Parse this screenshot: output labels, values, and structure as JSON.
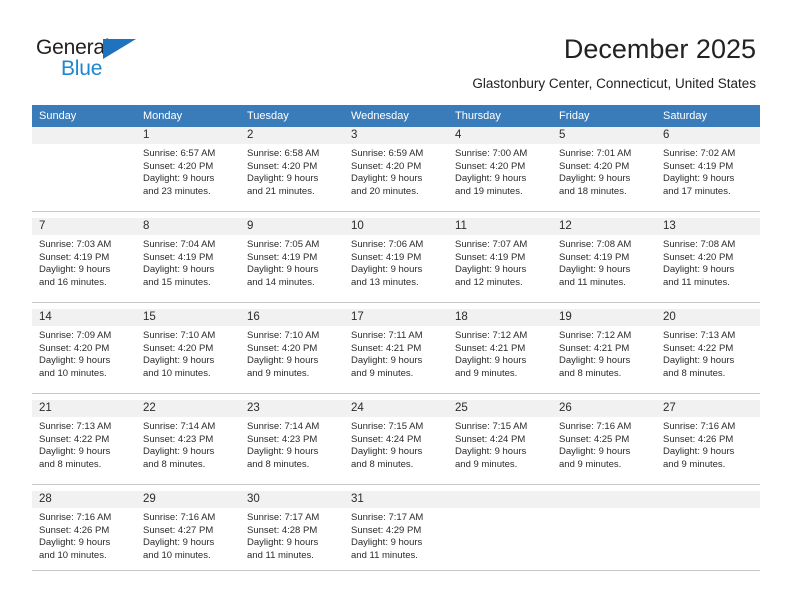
{
  "brand": {
    "name_top": "General",
    "name_bottom": "Blue",
    "color_dark": "#231f20",
    "color_blue": "#1f86d0",
    "triangle_color": "#1f72bd"
  },
  "header": {
    "month_title": "December 2025",
    "location": "Glastonbury Center, Connecticut, United States"
  },
  "theme": {
    "header_row_bg": "#3a7cba",
    "header_row_text": "#ffffff",
    "daynum_band_bg": "#f1f1f1",
    "grid_line": "#c8c8c8",
    "body_text": "#2b2b2b"
  },
  "weekday_headers": [
    "Sunday",
    "Monday",
    "Tuesday",
    "Wednesday",
    "Thursday",
    "Friday",
    "Saturday"
  ],
  "weeks": [
    [
      {
        "day": "",
        "empty": true,
        "sunrise": "",
        "sunset": "",
        "daylight_line1": "",
        "daylight_line2": ""
      },
      {
        "day": "1",
        "sunrise": "Sunrise: 6:57 AM",
        "sunset": "Sunset: 4:20 PM",
        "daylight_line1": "Daylight: 9 hours",
        "daylight_line2": "and 23 minutes."
      },
      {
        "day": "2",
        "sunrise": "Sunrise: 6:58 AM",
        "sunset": "Sunset: 4:20 PM",
        "daylight_line1": "Daylight: 9 hours",
        "daylight_line2": "and 21 minutes."
      },
      {
        "day": "3",
        "sunrise": "Sunrise: 6:59 AM",
        "sunset": "Sunset: 4:20 PM",
        "daylight_line1": "Daylight: 9 hours",
        "daylight_line2": "and 20 minutes."
      },
      {
        "day": "4",
        "sunrise": "Sunrise: 7:00 AM",
        "sunset": "Sunset: 4:20 PM",
        "daylight_line1": "Daylight: 9 hours",
        "daylight_line2": "and 19 minutes."
      },
      {
        "day": "5",
        "sunrise": "Sunrise: 7:01 AM",
        "sunset": "Sunset: 4:20 PM",
        "daylight_line1": "Daylight: 9 hours",
        "daylight_line2": "and 18 minutes."
      },
      {
        "day": "6",
        "sunrise": "Sunrise: 7:02 AM",
        "sunset": "Sunset: 4:19 PM",
        "daylight_line1": "Daylight: 9 hours",
        "daylight_line2": "and 17 minutes."
      }
    ],
    [
      {
        "day": "7",
        "sunrise": "Sunrise: 7:03 AM",
        "sunset": "Sunset: 4:19 PM",
        "daylight_line1": "Daylight: 9 hours",
        "daylight_line2": "and 16 minutes."
      },
      {
        "day": "8",
        "sunrise": "Sunrise: 7:04 AM",
        "sunset": "Sunset: 4:19 PM",
        "daylight_line1": "Daylight: 9 hours",
        "daylight_line2": "and 15 minutes."
      },
      {
        "day": "9",
        "sunrise": "Sunrise: 7:05 AM",
        "sunset": "Sunset: 4:19 PM",
        "daylight_line1": "Daylight: 9 hours",
        "daylight_line2": "and 14 minutes."
      },
      {
        "day": "10",
        "sunrise": "Sunrise: 7:06 AM",
        "sunset": "Sunset: 4:19 PM",
        "daylight_line1": "Daylight: 9 hours",
        "daylight_line2": "and 13 minutes."
      },
      {
        "day": "11",
        "sunrise": "Sunrise: 7:07 AM",
        "sunset": "Sunset: 4:19 PM",
        "daylight_line1": "Daylight: 9 hours",
        "daylight_line2": "and 12 minutes."
      },
      {
        "day": "12",
        "sunrise": "Sunrise: 7:08 AM",
        "sunset": "Sunset: 4:19 PM",
        "daylight_line1": "Daylight: 9 hours",
        "daylight_line2": "and 11 minutes."
      },
      {
        "day": "13",
        "sunrise": "Sunrise: 7:08 AM",
        "sunset": "Sunset: 4:20 PM",
        "daylight_line1": "Daylight: 9 hours",
        "daylight_line2": "and 11 minutes."
      }
    ],
    [
      {
        "day": "14",
        "sunrise": "Sunrise: 7:09 AM",
        "sunset": "Sunset: 4:20 PM",
        "daylight_line1": "Daylight: 9 hours",
        "daylight_line2": "and 10 minutes."
      },
      {
        "day": "15",
        "sunrise": "Sunrise: 7:10 AM",
        "sunset": "Sunset: 4:20 PM",
        "daylight_line1": "Daylight: 9 hours",
        "daylight_line2": "and 10 minutes."
      },
      {
        "day": "16",
        "sunrise": "Sunrise: 7:10 AM",
        "sunset": "Sunset: 4:20 PM",
        "daylight_line1": "Daylight: 9 hours",
        "daylight_line2": "and 9 minutes."
      },
      {
        "day": "17",
        "sunrise": "Sunrise: 7:11 AM",
        "sunset": "Sunset: 4:21 PM",
        "daylight_line1": "Daylight: 9 hours",
        "daylight_line2": "and 9 minutes."
      },
      {
        "day": "18",
        "sunrise": "Sunrise: 7:12 AM",
        "sunset": "Sunset: 4:21 PM",
        "daylight_line1": "Daylight: 9 hours",
        "daylight_line2": "and 9 minutes."
      },
      {
        "day": "19",
        "sunrise": "Sunrise: 7:12 AM",
        "sunset": "Sunset: 4:21 PM",
        "daylight_line1": "Daylight: 9 hours",
        "daylight_line2": "and 8 minutes."
      },
      {
        "day": "20",
        "sunrise": "Sunrise: 7:13 AM",
        "sunset": "Sunset: 4:22 PM",
        "daylight_line1": "Daylight: 9 hours",
        "daylight_line2": "and 8 minutes."
      }
    ],
    [
      {
        "day": "21",
        "sunrise": "Sunrise: 7:13 AM",
        "sunset": "Sunset: 4:22 PM",
        "daylight_line1": "Daylight: 9 hours",
        "daylight_line2": "and 8 minutes."
      },
      {
        "day": "22",
        "sunrise": "Sunrise: 7:14 AM",
        "sunset": "Sunset: 4:23 PM",
        "daylight_line1": "Daylight: 9 hours",
        "daylight_line2": "and 8 minutes."
      },
      {
        "day": "23",
        "sunrise": "Sunrise: 7:14 AM",
        "sunset": "Sunset: 4:23 PM",
        "daylight_line1": "Daylight: 9 hours",
        "daylight_line2": "and 8 minutes."
      },
      {
        "day": "24",
        "sunrise": "Sunrise: 7:15 AM",
        "sunset": "Sunset: 4:24 PM",
        "daylight_line1": "Daylight: 9 hours",
        "daylight_line2": "and 8 minutes."
      },
      {
        "day": "25",
        "sunrise": "Sunrise: 7:15 AM",
        "sunset": "Sunset: 4:24 PM",
        "daylight_line1": "Daylight: 9 hours",
        "daylight_line2": "and 9 minutes."
      },
      {
        "day": "26",
        "sunrise": "Sunrise: 7:16 AM",
        "sunset": "Sunset: 4:25 PM",
        "daylight_line1": "Daylight: 9 hours",
        "daylight_line2": "and 9 minutes."
      },
      {
        "day": "27",
        "sunrise": "Sunrise: 7:16 AM",
        "sunset": "Sunset: 4:26 PM",
        "daylight_line1": "Daylight: 9 hours",
        "daylight_line2": "and 9 minutes."
      }
    ],
    [
      {
        "day": "28",
        "sunrise": "Sunrise: 7:16 AM",
        "sunset": "Sunset: 4:26 PM",
        "daylight_line1": "Daylight: 9 hours",
        "daylight_line2": "and 10 minutes."
      },
      {
        "day": "29",
        "sunrise": "Sunrise: 7:16 AM",
        "sunset": "Sunset: 4:27 PM",
        "daylight_line1": "Daylight: 9 hours",
        "daylight_line2": "and 10 minutes."
      },
      {
        "day": "30",
        "sunrise": "Sunrise: 7:17 AM",
        "sunset": "Sunset: 4:28 PM",
        "daylight_line1": "Daylight: 9 hours",
        "daylight_line2": "and 11 minutes."
      },
      {
        "day": "31",
        "sunrise": "Sunrise: 7:17 AM",
        "sunset": "Sunset: 4:29 PM",
        "daylight_line1": "Daylight: 9 hours",
        "daylight_line2": "and 11 minutes."
      },
      {
        "day": "",
        "empty": true,
        "sunrise": "",
        "sunset": "",
        "daylight_line1": "",
        "daylight_line2": ""
      },
      {
        "day": "",
        "empty": true,
        "sunrise": "",
        "sunset": "",
        "daylight_line1": "",
        "daylight_line2": ""
      },
      {
        "day": "",
        "empty": true,
        "sunrise": "",
        "sunset": "",
        "daylight_line1": "",
        "daylight_line2": ""
      }
    ]
  ]
}
